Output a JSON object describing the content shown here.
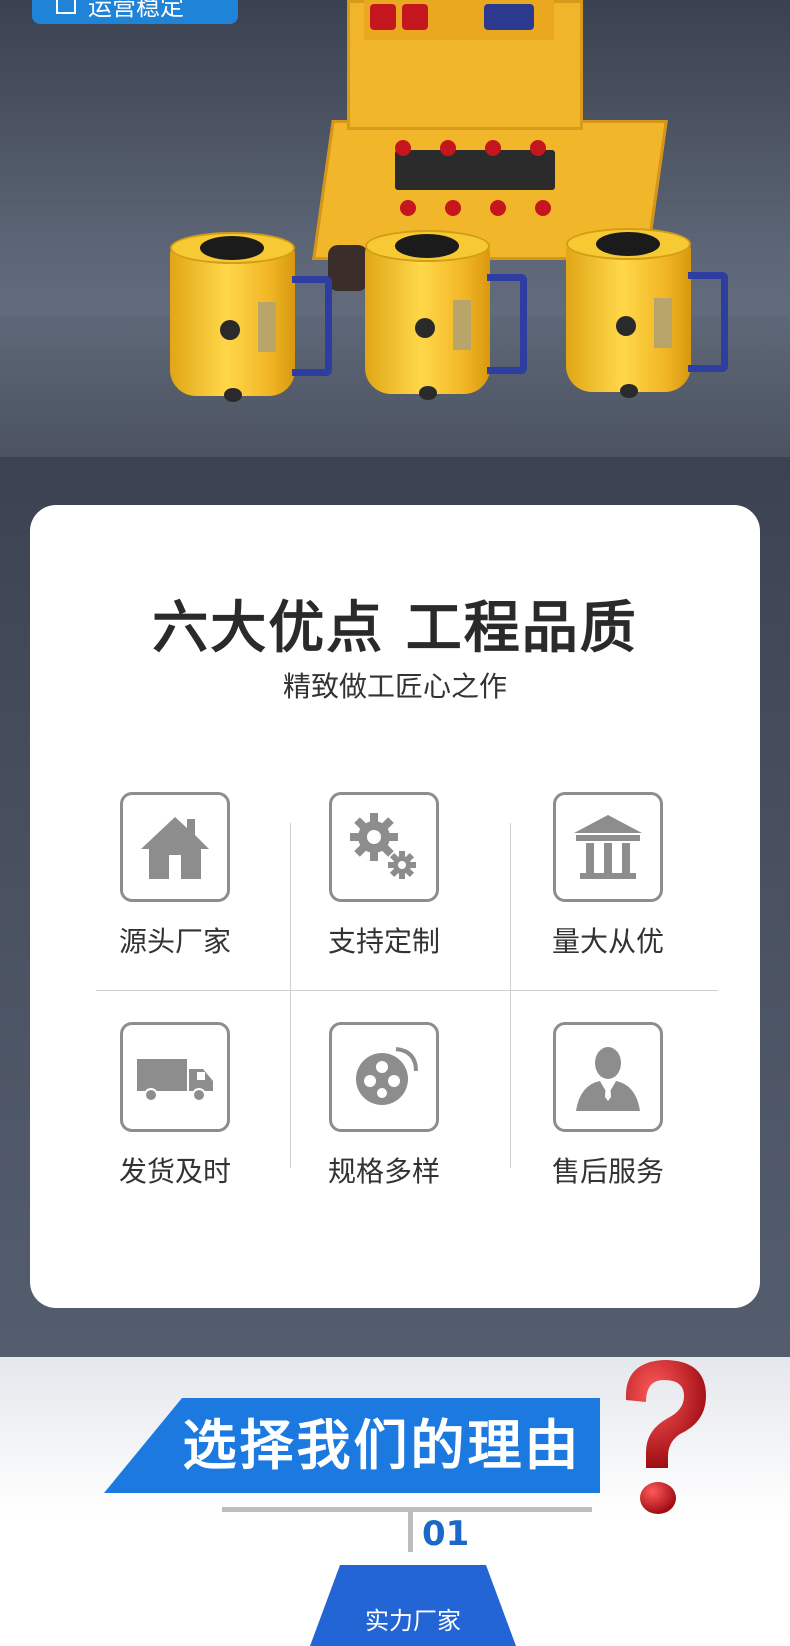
{
  "hero": {
    "badge_label": "运营稳定",
    "colors": {
      "badge": "#1f83d8",
      "cylinder": "#f7c933",
      "handle": "#2e3da0"
    }
  },
  "features": {
    "title": "六大优点  工程品质",
    "subtitle": "精致做工匠心之作",
    "items": [
      {
        "label": "源头厂家",
        "icon": "house-icon"
      },
      {
        "label": "支持定制",
        "icon": "gears-icon"
      },
      {
        "label": "量大从优",
        "icon": "bank-icon"
      },
      {
        "label": "发货及时",
        "icon": "truck-icon"
      },
      {
        "label": "规格多样",
        "icon": "film-reel-icon"
      },
      {
        "label": "售后服务",
        "icon": "person-icon"
      }
    ]
  },
  "reasons": {
    "banner_title": "选择我们的理由",
    "number": "01",
    "first_reason": "实力厂家",
    "colors": {
      "banner": "#1c79e0",
      "number": "#1c68c9",
      "question_mark": "#c4161c"
    }
  }
}
